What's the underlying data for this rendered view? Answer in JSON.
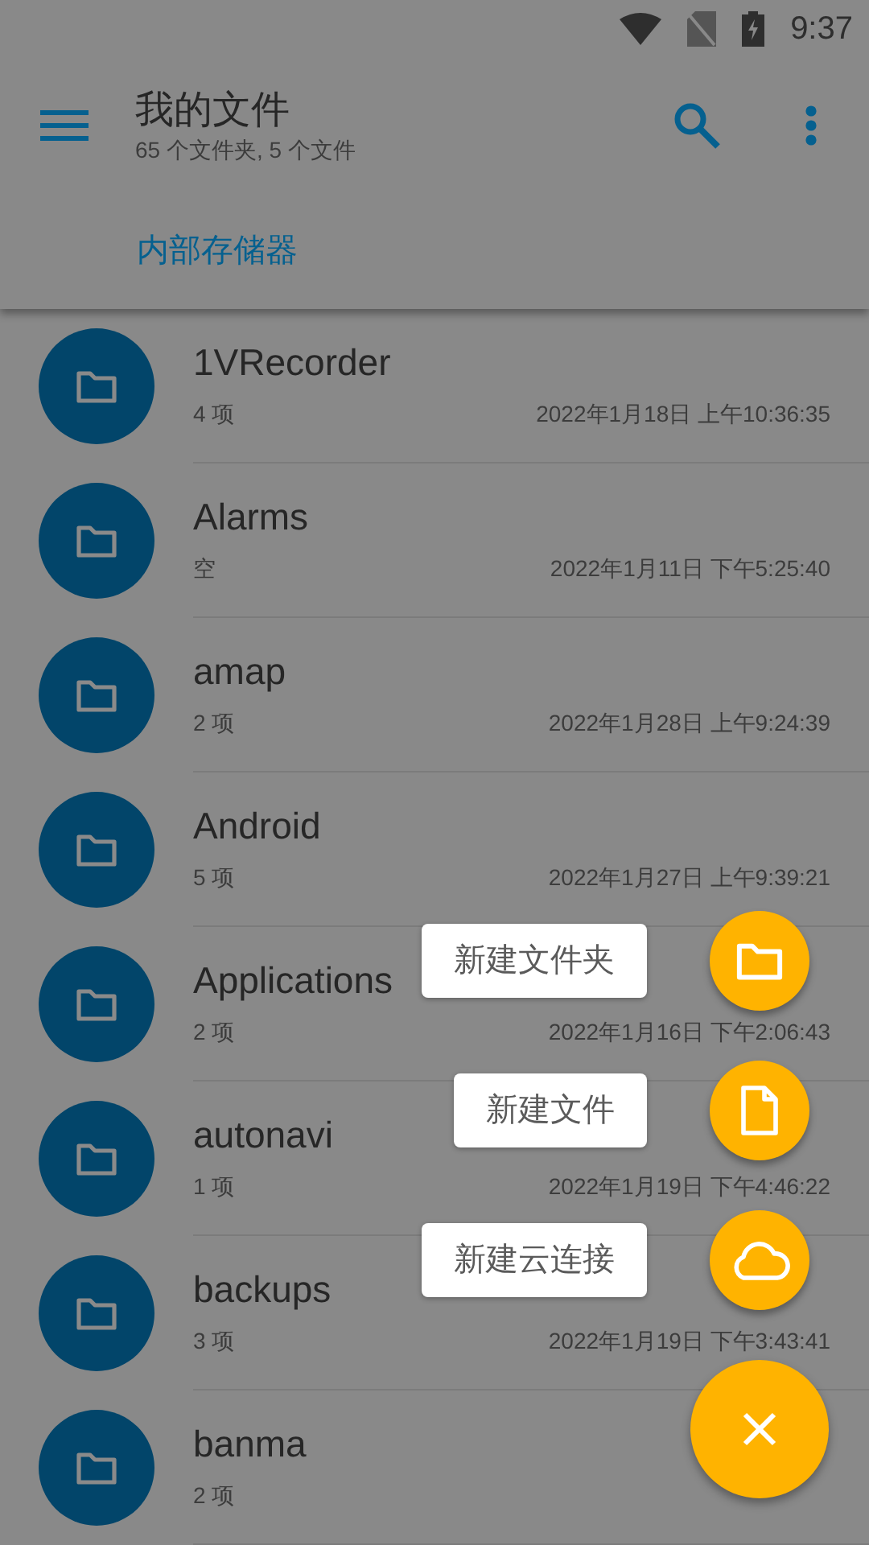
{
  "status_bar": {
    "time": "9:37"
  },
  "app_bar": {
    "title": "我的文件",
    "subtitle": "65 个文件夹, 5 个文件"
  },
  "breadcrumb": {
    "label": "内部存储器"
  },
  "files": [
    {
      "name": "1VRecorder",
      "info": "4 项",
      "modified": "2022年1月18日 上午10:36:35"
    },
    {
      "name": "Alarms",
      "info": "空",
      "modified": "2022年1月11日 下午5:25:40"
    },
    {
      "name": "amap",
      "info": "2 项",
      "modified": "2022年1月28日 上午9:24:39"
    },
    {
      "name": "Android",
      "info": "5 项",
      "modified": "2022年1月27日 上午9:39:21"
    },
    {
      "name": "Applications",
      "info": "2 项",
      "modified": "2022年1月16日 下午2:06:43"
    },
    {
      "name": "autonavi",
      "info": "1 项",
      "modified": "2022年1月19日 下午4:46:22"
    },
    {
      "name": "backups",
      "info": "3 项",
      "modified": "2022年1月19日 下午3:43:41"
    },
    {
      "name": "banma",
      "info": "2 项"
    }
  ],
  "fab_menu": {
    "actions": [
      {
        "label": "新建文件夹",
        "kind": "folder"
      },
      {
        "label": "新建文件",
        "kind": "file"
      },
      {
        "label": "新建云连接",
        "kind": "cloud"
      }
    ]
  }
}
